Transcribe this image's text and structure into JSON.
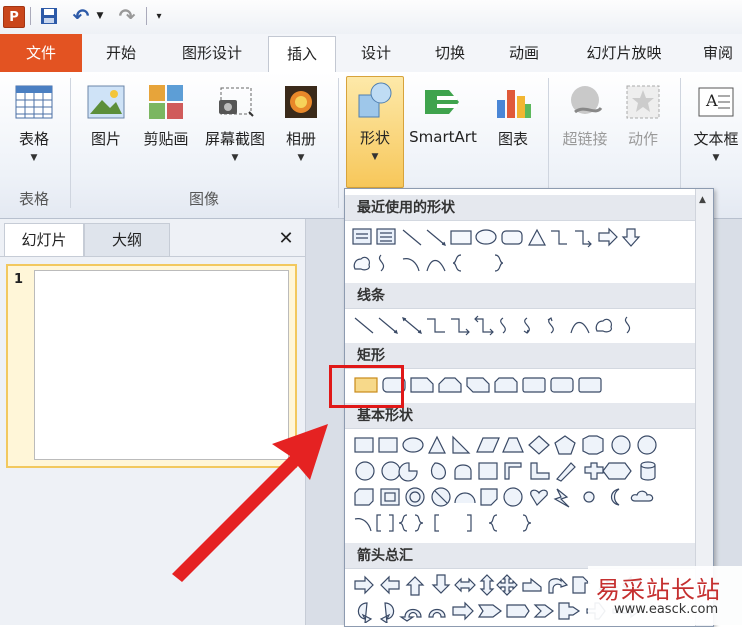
{
  "qat": {
    "logo": "P",
    "undo": "↶",
    "redo": "↷"
  },
  "tabs": [
    "文件",
    "开始",
    "图形设计",
    "插入",
    "设计",
    "切换",
    "动画",
    "幻灯片放映",
    "审阅"
  ],
  "ribbon": {
    "table": "表格",
    "picture": "图片",
    "clipart": "剪贴画",
    "screenshot": "屏幕截图",
    "album": "相册",
    "shapes": "形状",
    "smartart": "SmartArt",
    "chart": "图表",
    "hyperlink": "超链接",
    "action": "动作",
    "textbox": "文本框",
    "group_table": "表格",
    "group_image": "图像"
  },
  "pane": {
    "tab_slides": "幻灯片",
    "tab_outline": "大纲",
    "close": "✕",
    "slide_number": "1"
  },
  "gallery": {
    "recent": "最近使用的形状",
    "lines": "线条",
    "rectangles": "矩形",
    "basic": "基本形状",
    "arrows": "箭头总汇"
  },
  "watermark": {
    "title": "易采站长站",
    "url": "www.easck.com"
  },
  "colors": {
    "file_tab": "#e35322",
    "highlight": "#e01818",
    "arrow": "#e52222"
  }
}
